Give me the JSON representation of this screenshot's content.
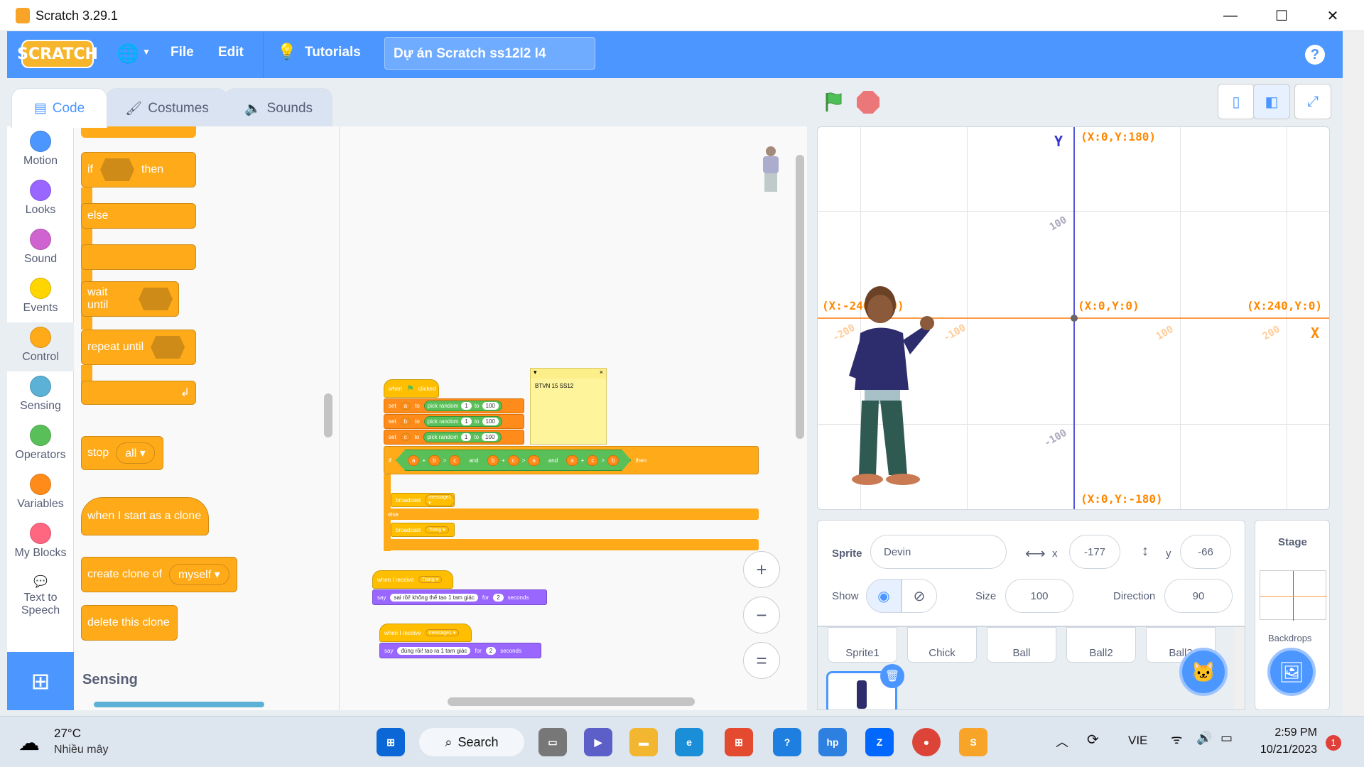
{
  "window": {
    "title": "Scratch 3.29.1",
    "minimize": "—",
    "maximize": "☐",
    "close": "✕"
  },
  "menubar": {
    "logo": "SCRATCH",
    "file": "File",
    "edit": "Edit",
    "tutorials": "Tutorials",
    "project_title": "Dự án Scratch ss12l2 l4",
    "help": "?"
  },
  "tabs": [
    {
      "label": "Code"
    },
    {
      "label": "Costumes"
    },
    {
      "label": "Sounds"
    }
  ],
  "categories": [
    {
      "label": "Motion",
      "color": "#4c97ff"
    },
    {
      "label": "Looks",
      "color": "#9966ff"
    },
    {
      "label": "Sound",
      "color": "#cf63cf"
    },
    {
      "label": "Events",
      "color": "#ffd500"
    },
    {
      "label": "Control",
      "color": "#ffab19"
    },
    {
      "label": "Sensing",
      "color": "#5cb1d6"
    },
    {
      "label": "Operators",
      "color": "#59c059"
    },
    {
      "label": "Variables",
      "color": "#ff8c1a"
    },
    {
      "label": "My Blocks",
      "color": "#ff6680"
    },
    {
      "label": "Text to Speech",
      "color": "#0fbd8c"
    }
  ],
  "palette": {
    "if": "if",
    "then": "then",
    "else": "else",
    "wait_until": "wait until",
    "repeat_until": "repeat until",
    "stop": "stop",
    "stop_opt": "all",
    "start_clone": "when I start as a clone",
    "create_clone": "create clone of",
    "clone_opt": "myself",
    "delete_clone": "delete this clone",
    "sensing_heading": "Sensing"
  },
  "script": {
    "hat": "when",
    "hat2": "clicked",
    "set_rows": [
      {
        "set": "set",
        "var": "a",
        "to": "to",
        "pick": "pick random",
        "from": "1",
        "to2": "to",
        "max": "100"
      },
      {
        "set": "set",
        "var": "b",
        "to": "to",
        "pick": "pick random",
        "from": "1",
        "to2": "to",
        "max": "100"
      },
      {
        "set": "set",
        "var": "c",
        "to": "to",
        "pick": "pick random",
        "from": "1",
        "to2": "to",
        "max": "100"
      }
    ],
    "if": "if",
    "then": "then",
    "and": "and",
    "plus": "+",
    "gt": ">",
    "cond1": [
      "a",
      "b",
      "c"
    ],
    "cond2": [
      "b",
      "c",
      "a"
    ],
    "cond3": [
      "a",
      "c",
      "b"
    ],
    "broadcast": "broadcast",
    "msg1": "message1",
    "else": "else",
    "msg2": "Trang",
    "note": "BTVN 15 SS12",
    "note_close": "×",
    "recv1": "when I receive",
    "recv1_opt": "Trang",
    "say": "say",
    "say1_text": "sai rồi! không thể tạo 1 tam giác",
    "for": "for",
    "secs": "2",
    "seconds": "seconds",
    "recv2": "when I receive",
    "recv2_opt": "message1",
    "say2_text": "đúng rồi! tạo ra 1 tam giác"
  },
  "zoom": {
    "in": "+",
    "out": "−",
    "reset": "="
  },
  "stage": {
    "y_axis": "Y",
    "x_axis": "X",
    "top": "(X:0,Y:180)",
    "left": "(X:-240,Y:0)",
    "center": "(X:0,Y:0)",
    "right": "(X:240,Y:0)",
    "bottom": "(X:0,Y:-180)",
    "ticks": {
      "y100": "100",
      "ym100": "-100",
      "xm200": "-200",
      "xm100": "-100",
      "x100": "100",
      "x200": "200"
    }
  },
  "sprite_info": {
    "sprite_label": "Sprite",
    "name": "Devin",
    "x_label": "x",
    "x": "-177",
    "y_label": "y",
    "y": "-66",
    "show_label": "Show",
    "size_label": "Size",
    "size": "100",
    "direction_label": "Direction",
    "direction": "90"
  },
  "sprites": [
    "Sprite1",
    "Chick",
    "Ball",
    "Ball2",
    "Ball3"
  ],
  "stage_pane": {
    "title": "Stage",
    "backdrops": "Backdrops"
  },
  "taskbar": {
    "temp": "27°C",
    "weather": "Nhiều mây",
    "search": "Search",
    "lang": "VIE",
    "time": "2:59 PM",
    "date": "10/21/2023",
    "notif": "1"
  },
  "colors": {
    "accent": "#4c97ff",
    "control": "#ffab19",
    "operators": "#59c059",
    "variables": "#ff8c1a",
    "looks": "#9966ff"
  }
}
